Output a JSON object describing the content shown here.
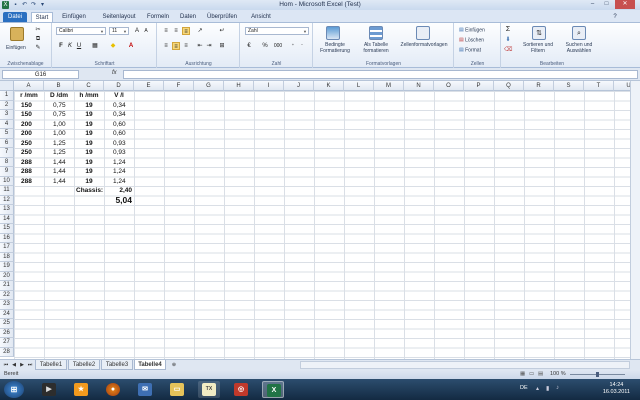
{
  "window": {
    "title": "Hom - Microsoft Excel (Test)",
    "min": "–",
    "max": "□",
    "close": "✕"
  },
  "tabs": [
    "Datei",
    "Start",
    "Einfügen",
    "Seitenlayout",
    "Formeln",
    "Daten",
    "Überprüfen",
    "Ansicht"
  ],
  "ribbon": {
    "clipboard": {
      "label": "Zwischenablage",
      "paste": "Einfügen"
    },
    "font": {
      "label": "Schriftart",
      "name": "Calibri",
      "size": "11",
      "bold": "F",
      "italic": "K",
      "underline": "U"
    },
    "alignment": {
      "label": "Ausrichtung"
    },
    "number": {
      "label": "Zahl",
      "format": "Zahl",
      "percent": "%",
      "thousands": "000"
    },
    "styles": {
      "label": "Formatvorlagen",
      "conditional": "Bedingte Formatierung",
      "table": "Als Tabelle formatieren",
      "cellstyles": "Zellenformatvorlagen"
    },
    "cells": {
      "label": "Zellen",
      "insert": "Einfügen",
      "delete": "Löschen",
      "format": "Format"
    },
    "editing": {
      "label": "Bearbeiten",
      "sort": "Sortieren und Filtern",
      "find": "Suchen und Auswählen",
      "sum": "Σ"
    }
  },
  "formula": {
    "namebox": "G16",
    "fx": "fx",
    "value": ""
  },
  "columns": [
    "A",
    "B",
    "C",
    "D",
    "E",
    "F",
    "G",
    "H",
    "I",
    "J",
    "K",
    "L",
    "M",
    "N",
    "O",
    "P",
    "Q",
    "R",
    "S",
    "T",
    "U"
  ],
  "rows": [
    "1",
    "2",
    "3",
    "4",
    "5",
    "6",
    "7",
    "8",
    "9",
    "10",
    "11",
    "12",
    "13",
    "14",
    "15",
    "16",
    "17",
    "18",
    "19",
    "20",
    "21",
    "22",
    "23",
    "24",
    "25",
    "26",
    "27",
    "28"
  ],
  "table": {
    "headers": [
      "r /mm",
      "D /dm",
      "h /mm",
      "V /l"
    ],
    "data": [
      [
        "150",
        "0,75",
        "19",
        "0,34"
      ],
      [
        "150",
        "0,75",
        "19",
        "0,34"
      ],
      [
        "200",
        "1,00",
        "19",
        "0,60"
      ],
      [
        "200",
        "1,00",
        "19",
        "0,60"
      ],
      [
        "250",
        "1,25",
        "19",
        "0,93"
      ],
      [
        "250",
        "1,25",
        "19",
        "0,93"
      ],
      [
        "288",
        "1,44",
        "19",
        "1,24"
      ],
      [
        "288",
        "1,44",
        "19",
        "1,24"
      ],
      [
        "288",
        "1,44",
        "19",
        "1,24"
      ]
    ],
    "chassis_label": "Chassis:",
    "chassis_value": "2,40",
    "total": "5,04"
  },
  "sheets": [
    "Tabelle1",
    "Tabelle2",
    "Tabelle3",
    "Tabelle4"
  ],
  "active_sheet": "Tabelle4",
  "status": {
    "ready": "Bereit",
    "zoom": "100 %"
  },
  "taskbar": {
    "lang": "DE",
    "time": "14:24",
    "date": "16.03.2011"
  }
}
